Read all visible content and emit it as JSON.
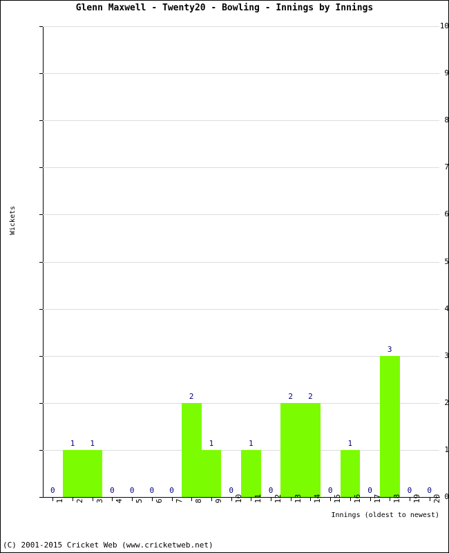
{
  "chart_data": {
    "type": "bar",
    "title": "Glenn Maxwell - Twenty20 - Bowling - Innings by Innings",
    "xlabel": "Innings (oldest to newest)",
    "ylabel": "Wickets",
    "categories": [
      "1",
      "2",
      "3",
      "4",
      "5",
      "6",
      "7",
      "8",
      "9",
      "10",
      "11",
      "12",
      "13",
      "14",
      "15",
      "16",
      "17",
      "18",
      "19",
      "20"
    ],
    "values": [
      0,
      1,
      1,
      0,
      0,
      0,
      0,
      2,
      1,
      0,
      1,
      0,
      2,
      2,
      0,
      1,
      0,
      3,
      0,
      0
    ],
    "value_labels": [
      "0",
      "1",
      "1",
      "0",
      "0",
      "0",
      "0",
      "2",
      "1",
      "0",
      "1",
      "0",
      "2",
      "2",
      "0",
      "1",
      "0",
      "3",
      "0",
      "0"
    ],
    "ylim": [
      0,
      10
    ],
    "ytick_labels": [
      "0",
      "1",
      "2",
      "3",
      "4",
      "5",
      "6",
      "7",
      "8",
      "9",
      "10"
    ],
    "grid": true,
    "legend": "none",
    "bar_color": "#7CFC00",
    "value_label_color": "#000080",
    "grid_color": "#DCDCDC",
    "axis_color": "#000000"
  },
  "footer": {
    "copyright": "(C) 2001-2015 Cricket Web (www.cricketweb.net)"
  }
}
